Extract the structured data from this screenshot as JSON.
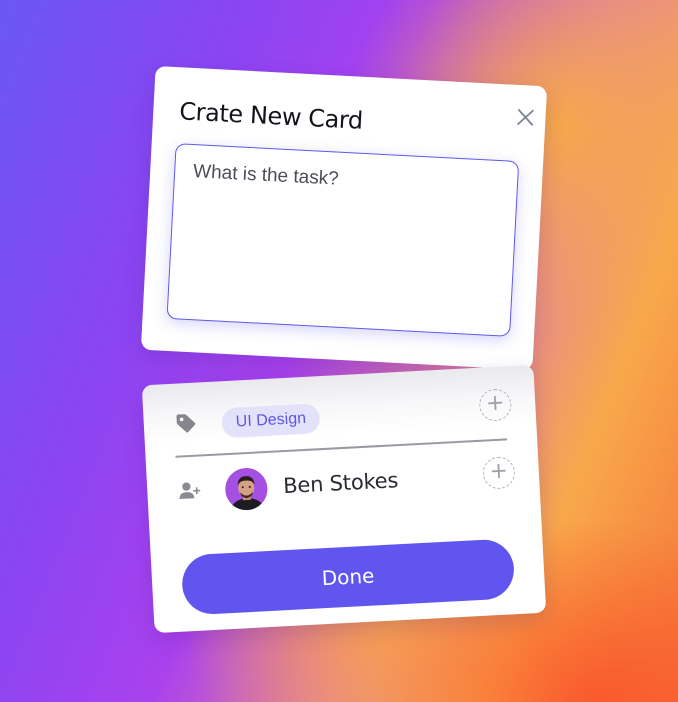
{
  "dialog": {
    "title": "Crate New Card",
    "task_input": {
      "placeholder": "What is the task?",
      "value": ""
    },
    "tags": {
      "icon": "tag-icon",
      "items": [
        "UI Design"
      ],
      "add_icon": "plus-icon"
    },
    "assignees": {
      "icon": "add-user-icon",
      "items": [
        {
          "name": "Ben Stokes",
          "avatar": "avatar-photo"
        }
      ],
      "add_icon": "plus-icon"
    },
    "done_label": "Done",
    "close_icon": "close-icon"
  },
  "colors": {
    "accent": "#6155f0",
    "chip_background": "#e4e2fb",
    "chip_text": "#5c57e6",
    "input_border": "#6158f0"
  }
}
